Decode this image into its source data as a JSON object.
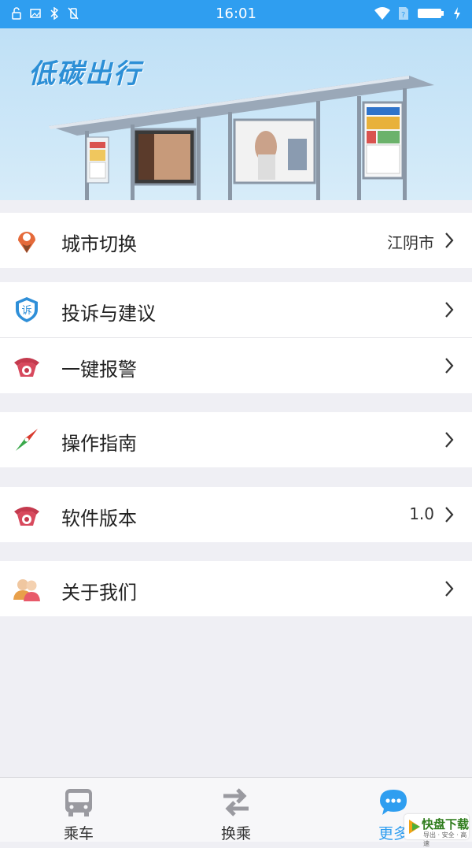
{
  "status_bar": {
    "time": "16:01"
  },
  "banner": {
    "logo_text": "低碳出行"
  },
  "menu": {
    "city_switch": {
      "label": "城市切换",
      "value": "江阴市",
      "icon": "location-pin-icon"
    },
    "complaint": {
      "label": "投诉与建议",
      "icon": "complaint-shield-icon"
    },
    "alarm": {
      "label": "一键报警",
      "icon": "telephone-icon"
    },
    "guide": {
      "label": "操作指南",
      "icon": "compass-icon"
    },
    "version": {
      "label": "软件版本",
      "value": "1.0",
      "icon": "telephone-icon"
    },
    "about": {
      "label": "关于我们",
      "icon": "people-icon"
    }
  },
  "tab_bar": {
    "tabs": [
      {
        "label": "乘车",
        "icon": "bus-icon",
        "active": false
      },
      {
        "label": "换乘",
        "icon": "transfer-arrows-icon",
        "active": false
      },
      {
        "label": "更多",
        "icon": "chat-bubble-icon",
        "active": true
      }
    ],
    "watermark": {
      "main": "快盘下载",
      "sub": "导出 · 安全 · 高速"
    }
  },
  "colors": {
    "accent": "#2f9ef0",
    "background": "#efeff4"
  }
}
